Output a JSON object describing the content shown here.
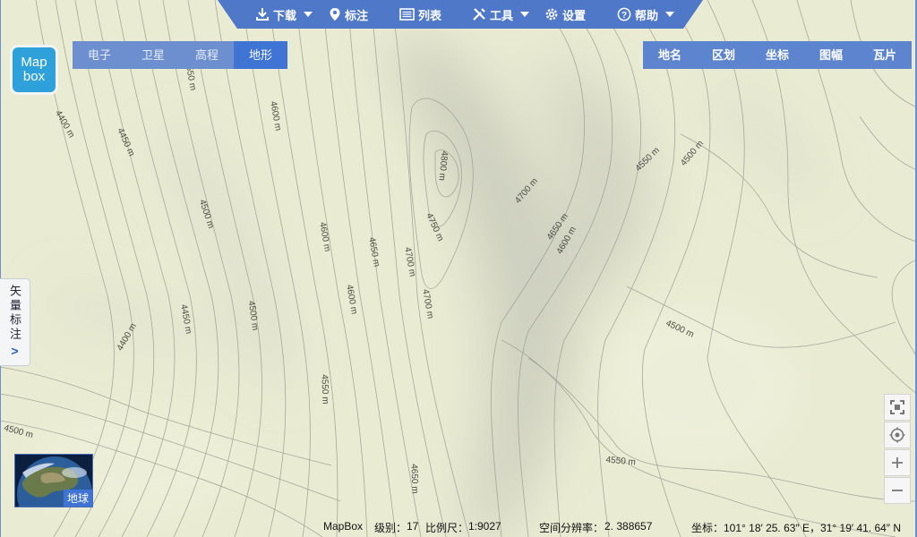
{
  "toolbar": {
    "download": "下载",
    "marker": "标注",
    "list": "列表",
    "tools": "工具",
    "settings": "设置",
    "help": "帮助"
  },
  "logo": {
    "line1": "Map",
    "line2": "box"
  },
  "map_types": [
    "电子",
    "卫星",
    "高程",
    "地形"
  ],
  "active_map_type": "地形",
  "layers": [
    "地名",
    "区划",
    "坐标",
    "图幅",
    "瓦片"
  ],
  "side_panel": {
    "label": "矢量标注",
    "arrow": ">"
  },
  "globe_label": "地球",
  "contours": [
    {
      "text": "4550 m"
    },
    {
      "text": "4400 m"
    },
    {
      "text": "4450 m"
    },
    {
      "text": "4600 m"
    },
    {
      "text": "4500 m"
    },
    {
      "text": "4800 m"
    },
    {
      "text": "4600 m"
    },
    {
      "text": "4650 m"
    },
    {
      "text": "4750 m"
    },
    {
      "text": "4700 m"
    },
    {
      "text": "4700 m"
    },
    {
      "text": "4650 m"
    },
    {
      "text": "4600 m"
    },
    {
      "text": "4550 m"
    },
    {
      "text": "4500 m"
    },
    {
      "text": "4450 m"
    },
    {
      "text": "4400 m"
    },
    {
      "text": "4500 m"
    },
    {
      "text": "4600 m"
    },
    {
      "text": "4700 m"
    },
    {
      "text": "4500 m"
    },
    {
      "text": "4550 m"
    },
    {
      "text": "4500 m"
    },
    {
      "text": "4650 m"
    },
    {
      "text": "4550 m"
    }
  ],
  "status": {
    "source": "MapBox",
    "level_label": "级别：",
    "level": "17",
    "scale_label": "比例尺：",
    "scale": "1:9027",
    "resolution_label": "空间分辨率：",
    "resolution": "2. 388657",
    "coord_label": "坐标：",
    "coord": "101° 18′ 25. 63″ E，31° 19′ 41. 64″ N"
  },
  "colors": {
    "accent": "#3f73d4",
    "toolbar": "#4f78c8",
    "terrain": "#e9ebd2",
    "contour": "#8f948a"
  }
}
